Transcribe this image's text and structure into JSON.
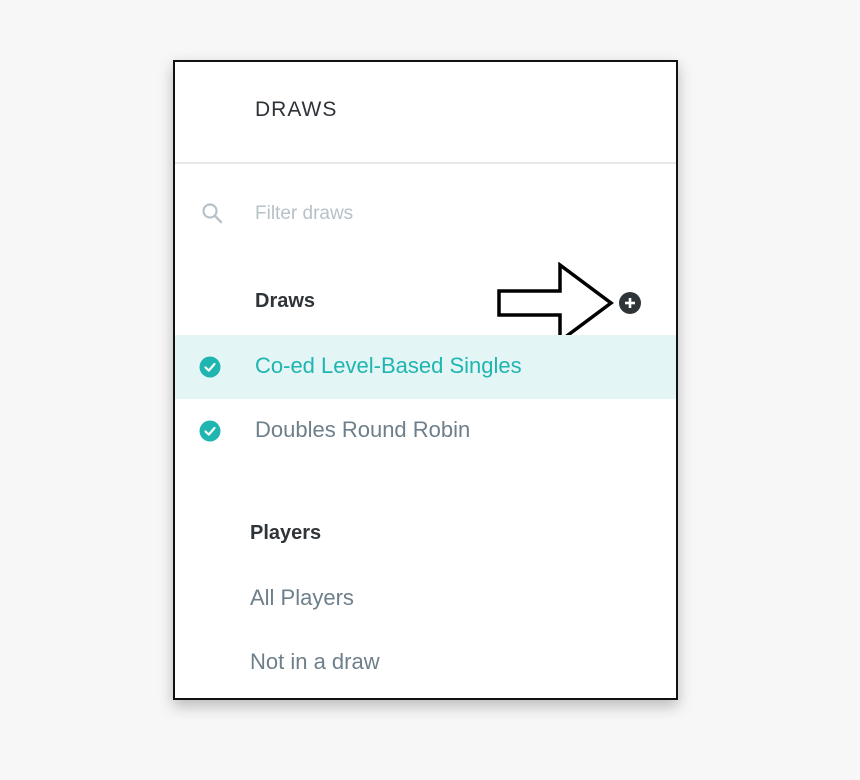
{
  "header": {
    "title": "DRAWS"
  },
  "search": {
    "placeholder": "Filter draws",
    "value": "",
    "icon": "search-icon"
  },
  "draws_section": {
    "title": "Draws",
    "add_icon": "plus-circle-icon",
    "items": [
      {
        "label": "Co-ed Level-Based Singles",
        "selected": true,
        "icon": "check-circle-icon"
      },
      {
        "label": "Doubles Round Robin",
        "selected": false,
        "icon": "check-circle-icon"
      }
    ]
  },
  "players_section": {
    "title": "Players",
    "items": [
      {
        "label": "All Players"
      },
      {
        "label": "Not in a draw"
      }
    ]
  },
  "colors": {
    "accent": "#1fb5b0",
    "selected_bg": "#e3f5f5",
    "text_dark": "#2f3438",
    "text_muted": "#6d7f8a",
    "placeholder": "#b7c1c8",
    "page_bg": "#f7f7f7"
  }
}
